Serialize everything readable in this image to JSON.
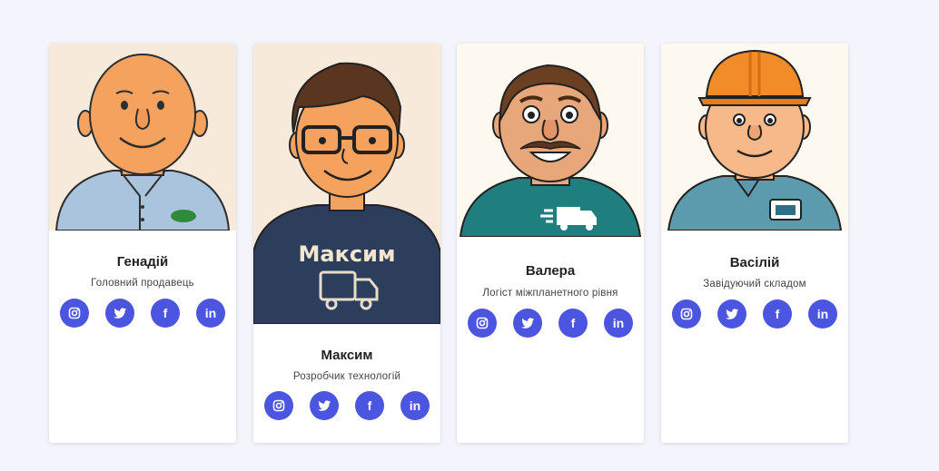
{
  "team": [
    {
      "name": "Генадій",
      "role": "Головний продавець"
    },
    {
      "name": "Максим",
      "role": "Розробчик технологій",
      "shirt_text": "Максим"
    },
    {
      "name": "Валера",
      "role": "Логіст міжпланетного рівня"
    },
    {
      "name": "Васілій",
      "role": "Завідуючий складом"
    }
  ],
  "social": {
    "facebook_glyph": "f",
    "linkedin_glyph": "in"
  },
  "colors": {
    "accent": "#4b55e0",
    "page_bg": "#f3f4fc",
    "card_bg": "#ffffff"
  }
}
